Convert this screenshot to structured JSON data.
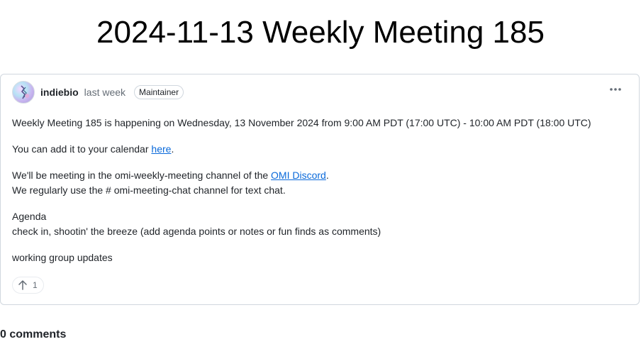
{
  "page_title": "2024-11-13 Weekly Meeting 185",
  "post": {
    "author": "indiebio",
    "timestamp": "last week",
    "badge": "Maintainer",
    "avatar_icon": "avatar-image",
    "more_icon": "kebab-horizontal-icon",
    "body": {
      "line1": "Weekly Meeting 185 is happening on Wednesday, 13 November 2024 from 9:00 AM PDT (17:00 UTC) - 10:00 AM PDT (18:00 UTC)",
      "calendar_prefix": "You can add it to your calendar ",
      "calendar_link": "here",
      "calendar_suffix": ".",
      "discord_prefix": "We'll be meeting in the omi-weekly-meeting channel of the ",
      "discord_link": "OMI Discord",
      "discord_suffix": ".",
      "chat_line": "We regularly use the # omi-meeting-chat channel for text chat.",
      "agenda_heading": "Agenda",
      "agenda_item": "check in, shootin' the breeze (add agenda points or notes or fun finds as comments)",
      "working_group": "working group updates"
    },
    "reaction": {
      "icon": "arrow-up-icon",
      "count": "1"
    }
  },
  "comments_count_label": "0 comments",
  "colors": {
    "link": "#0969da",
    "border": "#d0d7de",
    "muted": "#656d76"
  }
}
